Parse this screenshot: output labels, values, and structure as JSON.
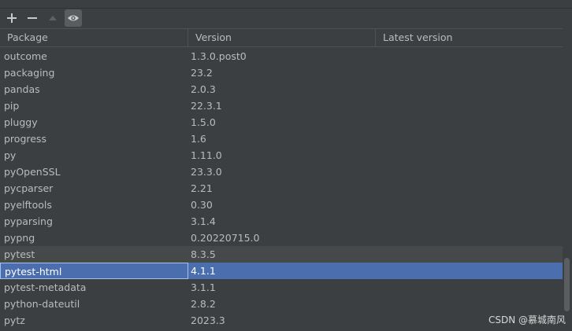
{
  "toolbar": {
    "buttons": [
      {
        "icon": "plus-icon",
        "label": "+"
      },
      {
        "icon": "minus-icon",
        "label": "−"
      },
      {
        "icon": "arrow-up-icon",
        "label": "▲"
      },
      {
        "icon": "eye-icon",
        "label": "eye"
      }
    ]
  },
  "table": {
    "columns": [
      "Package",
      "Version",
      "Latest version"
    ],
    "rows": [
      {
        "package": "outcome",
        "version": "1.3.0.post0",
        "latest": ""
      },
      {
        "package": "packaging",
        "version": "23.2",
        "latest": ""
      },
      {
        "package": "pandas",
        "version": "2.0.3",
        "latest": ""
      },
      {
        "package": "pip",
        "version": "22.3.1",
        "latest": ""
      },
      {
        "package": "pluggy",
        "version": "1.5.0",
        "latest": ""
      },
      {
        "package": "progress",
        "version": "1.6",
        "latest": ""
      },
      {
        "package": "py",
        "version": "1.11.0",
        "latest": ""
      },
      {
        "package": "pyOpenSSL",
        "version": "23.3.0",
        "latest": ""
      },
      {
        "package": "pycparser",
        "version": "2.21",
        "latest": ""
      },
      {
        "package": "pyelftools",
        "version": "0.30",
        "latest": ""
      },
      {
        "package": "pyparsing",
        "version": "3.1.4",
        "latest": ""
      },
      {
        "package": "pypng",
        "version": "0.20220715.0",
        "latest": ""
      },
      {
        "package": "pytest",
        "version": "8.3.5",
        "latest": ""
      },
      {
        "package": "pytest-html",
        "version": "4.1.1",
        "latest": ""
      },
      {
        "package": "pytest-metadata",
        "version": "3.1.1",
        "latest": ""
      },
      {
        "package": "python-dateutil",
        "version": "2.8.2",
        "latest": ""
      },
      {
        "package": "pytz",
        "version": "2023.3",
        "latest": ""
      }
    ],
    "hover_row": "pytest",
    "selected_row": "pytest-html"
  },
  "watermark": "CSDN @慕城南风",
  "colors": {
    "background": "#3c3f41",
    "selection": "#4b6eaf",
    "hover": "#45494a",
    "text": "#bbbbbb"
  }
}
